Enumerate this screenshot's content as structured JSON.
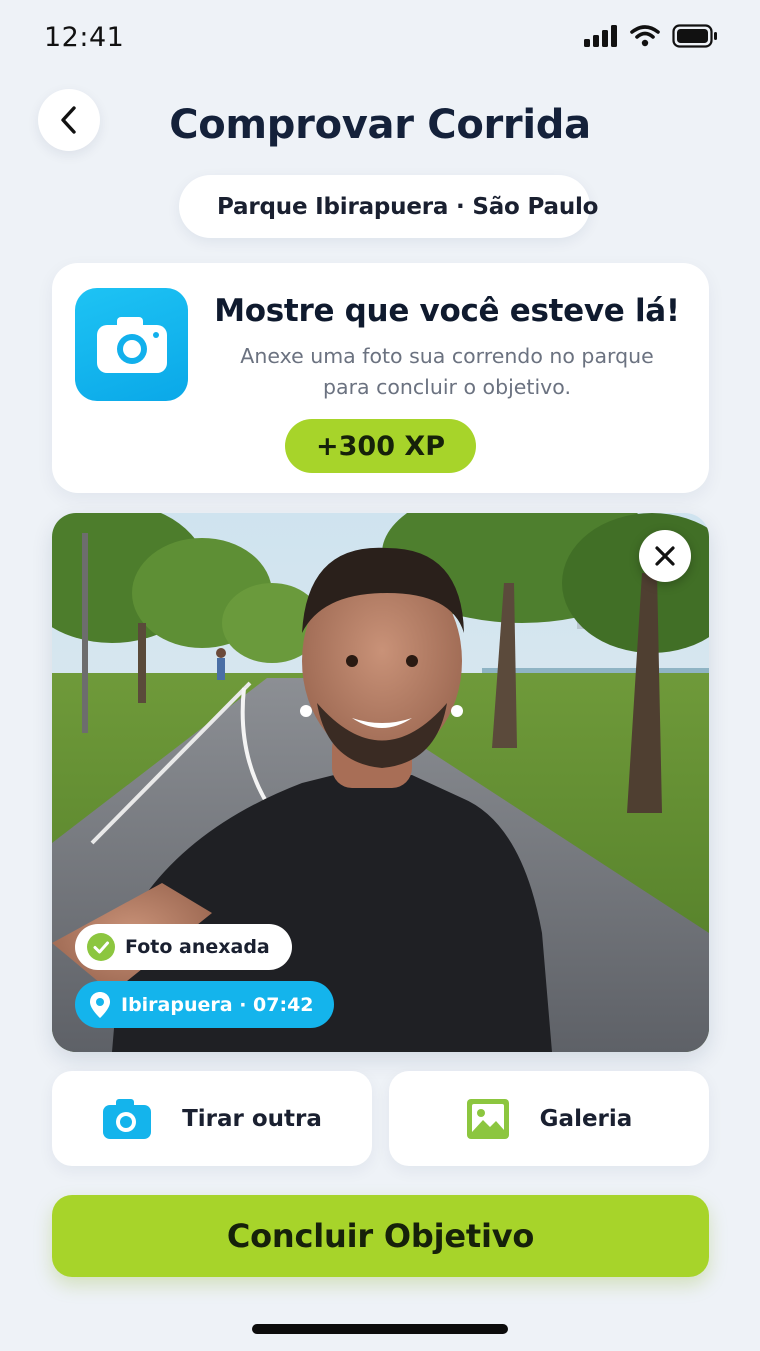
{
  "status_bar": {
    "time": "12:41"
  },
  "header": {
    "title": "Comprovar Corrida"
  },
  "location_pill": {
    "text": "Parque Ibirapuera · São Paulo",
    "icon": "park-icon"
  },
  "card": {
    "title": "Mostre que você esteve lá!",
    "description_line1": "Anexe uma foto sua correndo no parque",
    "description_line2": "para concluir o objetivo.",
    "xp": "+300 XP",
    "icon": "camera-icon"
  },
  "photo": {
    "attached_label": "Foto anexada",
    "location_time_label": "Ibirapuera · 07:42"
  },
  "actions": {
    "retake_label": "Tirar outra",
    "gallery_label": "Galeria"
  },
  "primary": {
    "label": "Concluir Objetivo"
  },
  "colors": {
    "accent_green": "#a7d42a",
    "accent_blue": "#14b4ec",
    "background": "#eef2f7"
  }
}
